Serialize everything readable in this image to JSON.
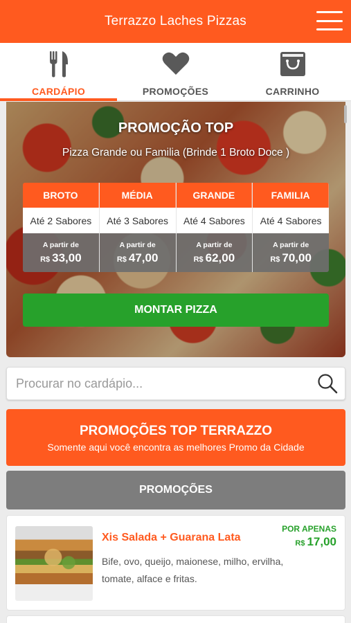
{
  "app": {
    "title": "Terrazzo Laches Pizzas",
    "accent": "#ff5a1f",
    "green": "#27a12b"
  },
  "tabs": [
    {
      "label": "CARDÁPIO",
      "icon": "fork-knife-icon",
      "active": true
    },
    {
      "label": "PROMOÇÕES",
      "icon": "heart-icon",
      "active": false
    },
    {
      "label": "CARRINHO",
      "icon": "shopping-bag-icon",
      "active": false
    }
  ],
  "hero": {
    "title": "PROMOÇÃO TOP",
    "subtitle": "Pizza Grande ou Familia (Brinde 1 Broto Doce )",
    "sizes": [
      {
        "name": "BROTO",
        "flavors": "Até 2 Sabores",
        "from_label": "A partir de",
        "currency": "R$",
        "price": "33,00"
      },
      {
        "name": "MÉDIA",
        "flavors": "Até 3 Sabores",
        "from_label": "A partir de",
        "currency": "R$",
        "price": "47,00"
      },
      {
        "name": "GRANDE",
        "flavors": "Até 4 Sabores",
        "from_label": "A partir de",
        "currency": "R$",
        "price": "62,00"
      },
      {
        "name": "FAMILIA",
        "flavors": "Até 4 Sabores",
        "from_label": "A partir de",
        "currency": "R$",
        "price": "70,00"
      }
    ],
    "button_label": "MONTAR PIZZA"
  },
  "search": {
    "placeholder": "Procurar no cardápio...",
    "icon": "search-icon"
  },
  "promo_banner": {
    "title": "PROMOÇÕES TOP TERRAZZO",
    "subtitle": "Somente aqui você encontra as melhores Promo da Cidade"
  },
  "section": {
    "title": "PROMOÇÕES"
  },
  "items": [
    {
      "name": "Xis Salada + Guarana Lata",
      "description": "Bife, ovo, queijo, maionese, milho, ervilha, tomate, alface e fritas.",
      "badge": "POR APENAS",
      "currency": "R$",
      "price": "17,00"
    }
  ]
}
